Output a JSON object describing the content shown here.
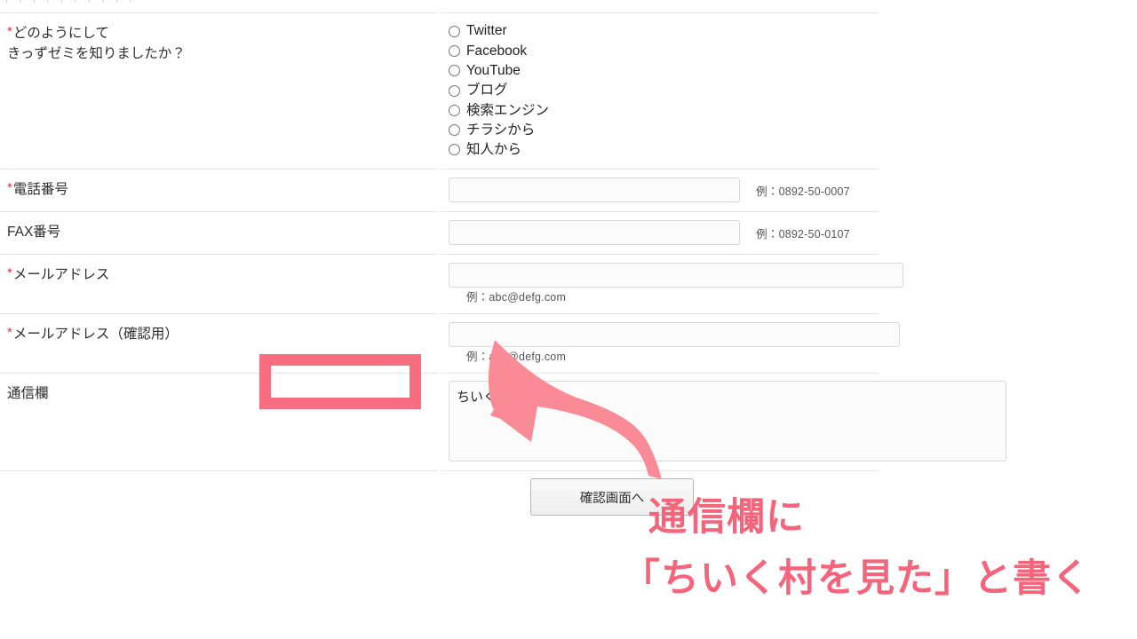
{
  "page": {
    "clipped_top_text": "＊＊＊＊＊＊＊＊＊＊"
  },
  "form": {
    "required_marker": "*",
    "rows": [
      {
        "name": "referral-source",
        "required": true,
        "label_line1": "どのようにして",
        "label_line2": "きっずゼミを知りましたか？",
        "type": "radio",
        "options": [
          "Twitter",
          "Facebook",
          "YouTube",
          "ブログ",
          "検索エンジン",
          "チラシから",
          "知人から"
        ],
        "selected": null
      },
      {
        "name": "tel",
        "required": true,
        "label_line1": "電話番号",
        "type": "text",
        "value": "",
        "hint": "例：0892-50-0007"
      },
      {
        "name": "fax",
        "required": false,
        "label_line1": "FAX番号",
        "type": "text",
        "value": "",
        "hint": "例：0892-50-0107"
      },
      {
        "name": "email",
        "required": true,
        "label_line1": "メールアドレス",
        "type": "text",
        "value": "",
        "hint": "例：abc@defg.com"
      },
      {
        "name": "email-confirm",
        "required": true,
        "label_line1": "メールアドレス（確認用）",
        "type": "text",
        "value": "",
        "hint": "例：abc@defg.com"
      },
      {
        "name": "message",
        "required": false,
        "label_line1": "通信欄",
        "type": "textarea",
        "value": "ちいく村を見た",
        "hint": ""
      }
    ],
    "submit_label": "確認画面へ"
  },
  "annotation": {
    "line1": "通信欄に",
    "line2": "「ちいく村を見た」と書く",
    "arrow_name": "curved-left-arrow",
    "highlight_target": "message-textarea",
    "colors": {
      "pink": "#f4647a",
      "arrow_pink": "#fa8b96",
      "highlight_pink": "#f76e80",
      "required_red": "#d8333f"
    }
  }
}
